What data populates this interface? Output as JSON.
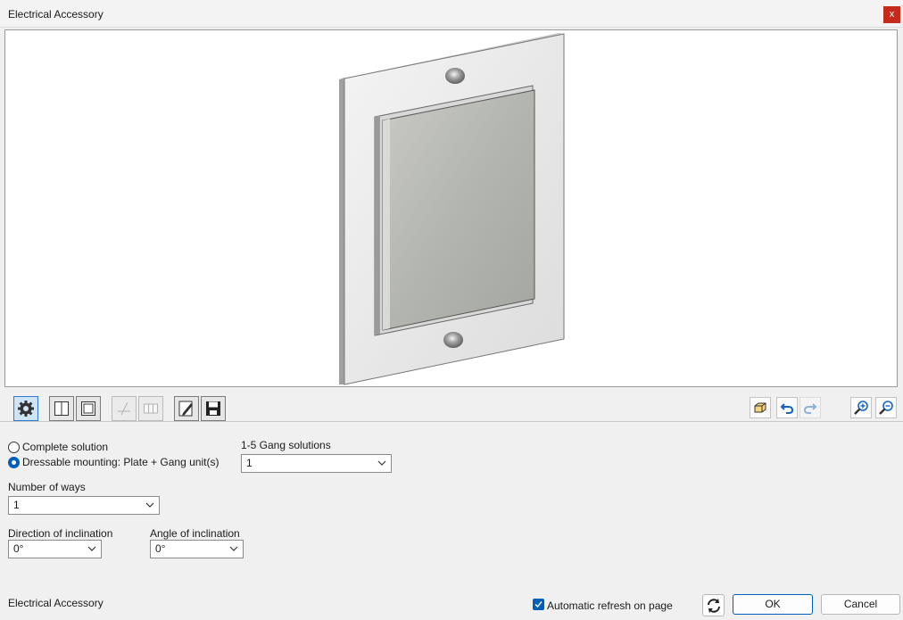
{
  "window": {
    "title": "Electrical Accessory",
    "close_label": "x"
  },
  "toolbar": {
    "left_icons": [
      "settings-gear-icon",
      "single-panel-icon",
      "frame-panel-icon",
      "pick-point-icon",
      "grid-layout-icon",
      "edit-document-icon",
      "save-disk-icon"
    ],
    "right_icons": [
      "3d-box-icon",
      "undo-icon",
      "redo-icon",
      "zoom-in-icon",
      "zoom-out-icon"
    ]
  },
  "mounting": {
    "options": [
      {
        "label": "Complete solution",
        "checked": false
      },
      {
        "label": "Dressable mounting: Plate + Gang unit(s)",
        "checked": true
      }
    ]
  },
  "gang_solutions": {
    "label": "1-5 Gang solutions",
    "value": "1"
  },
  "number_of_ways": {
    "label": "Number of ways",
    "value": "1"
  },
  "direction_of_inclination": {
    "label": "Direction of inclination",
    "value": "0°"
  },
  "angle_of_inclination": {
    "label": "Angle of inclination",
    "value": "0°"
  },
  "footer": {
    "status_text": "Electrical Accessory",
    "auto_refresh_label": "Automatic refresh on page",
    "auto_refresh_checked": true,
    "ok_label": "OK",
    "cancel_label": "Cancel"
  },
  "colors": {
    "accent": "#005fb8",
    "close": "#c42b1c"
  }
}
